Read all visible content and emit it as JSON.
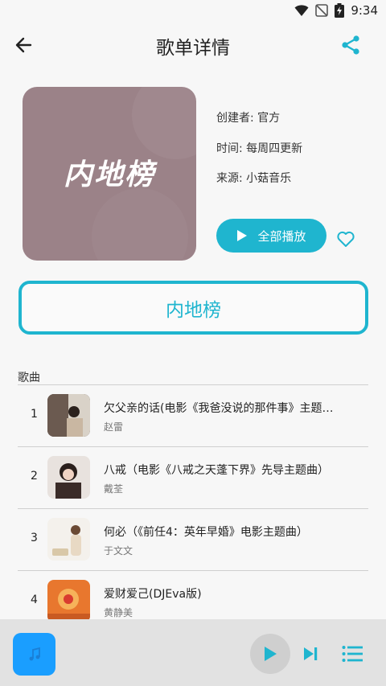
{
  "status_bar": {
    "time": "9:34"
  },
  "header": {
    "title": "歌单详情"
  },
  "cover": {
    "text": "内地榜"
  },
  "meta": {
    "creator": "创建者: 官方",
    "update_time": "时间: 每周四更新",
    "source": "来源: 小菇音乐"
  },
  "play_all_label": "全部播放",
  "list_title": "内地榜",
  "section_label": "歌曲",
  "songs": [
    {
      "num": "1",
      "title": "欠父亲的话(电影《我爸没说的那件事》主题…",
      "artist": "赵雷"
    },
    {
      "num": "2",
      "title": "八戒（电影《八戒之天蓬下界》先导主题曲）",
      "artist": "戴荃"
    },
    {
      "num": "3",
      "title": "何必（《前任4：英年早婚》电影主题曲）",
      "artist": "于文文"
    },
    {
      "num": "4",
      "title": "爱财爱己(DJEva版)",
      "artist": "黄静美"
    }
  ],
  "colors": {
    "accent": "#1fb5cf",
    "cover_bg": "#9b8288",
    "player_bg": "#e2e2e2"
  }
}
